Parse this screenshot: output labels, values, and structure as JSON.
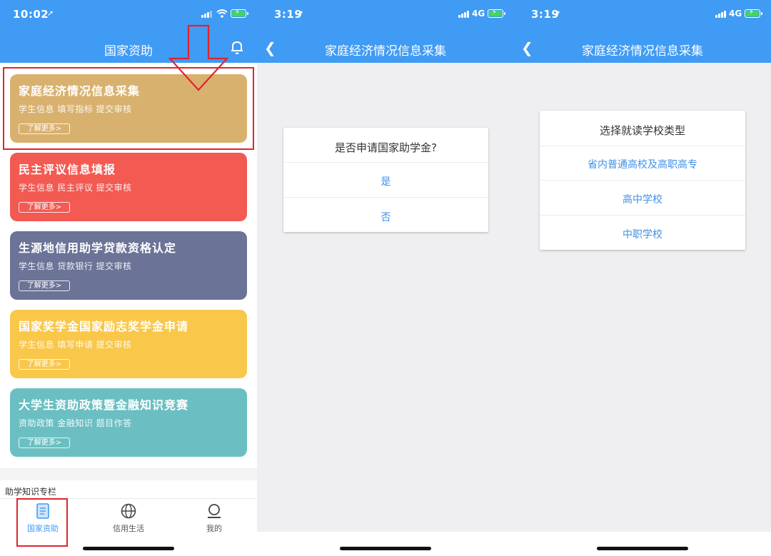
{
  "colors": {
    "header_blue": "#3f9bf4",
    "card_tan": "#d9b16f",
    "card_red": "#f25a52",
    "card_slate": "#6b7397",
    "card_yellow": "#f9c74a",
    "card_teal": "#6bbfc2",
    "annotation_red": "#e0242c"
  },
  "screen1": {
    "status": {
      "time": "10:02"
    },
    "nav_title": "国家资助",
    "cards": [
      {
        "title": "家庭经济情况信息采集",
        "sub": "学生信息  填写指标  提交审核",
        "btn": "了解更多>"
      },
      {
        "title": "民主评议信息填报",
        "sub": "学生信息  民主评议  提交审核",
        "btn": "了解更多>"
      },
      {
        "title": "生源地信用助学贷款资格认定",
        "sub": "学生信息  贷款银行  提交审核",
        "btn": "了解更多>"
      },
      {
        "title": "国家奖学金国家励志奖学金申请",
        "sub": "学生信息  填写申请  提交审核",
        "btn": "了解更多>"
      },
      {
        "title": "大学生资助政策暨金融知识竞赛",
        "sub": "资助政策  金融知识  题目作答",
        "btn": "了解更多>"
      }
    ],
    "section_label": "助学知识专栏",
    "tabs": [
      {
        "label": "国家资助",
        "icon": "book-icon"
      },
      {
        "label": "信用生活",
        "icon": "globe-icon"
      },
      {
        "label": "我的",
        "icon": "user-icon"
      }
    ]
  },
  "screen2": {
    "status": {
      "time": "3:19",
      "network": "4G"
    },
    "nav_title": "家庭经济情况信息采集",
    "dialog": {
      "title": "是否申请国家助学金?",
      "options": [
        "是",
        "否"
      ]
    }
  },
  "screen3": {
    "status": {
      "time": "3:19",
      "network": "4G"
    },
    "nav_title": "家庭经济情况信息采集",
    "dialog": {
      "title": "选择就读学校类型",
      "options": [
        "省内普通高校及高职高专",
        "高中学校",
        "中职学校"
      ]
    }
  }
}
